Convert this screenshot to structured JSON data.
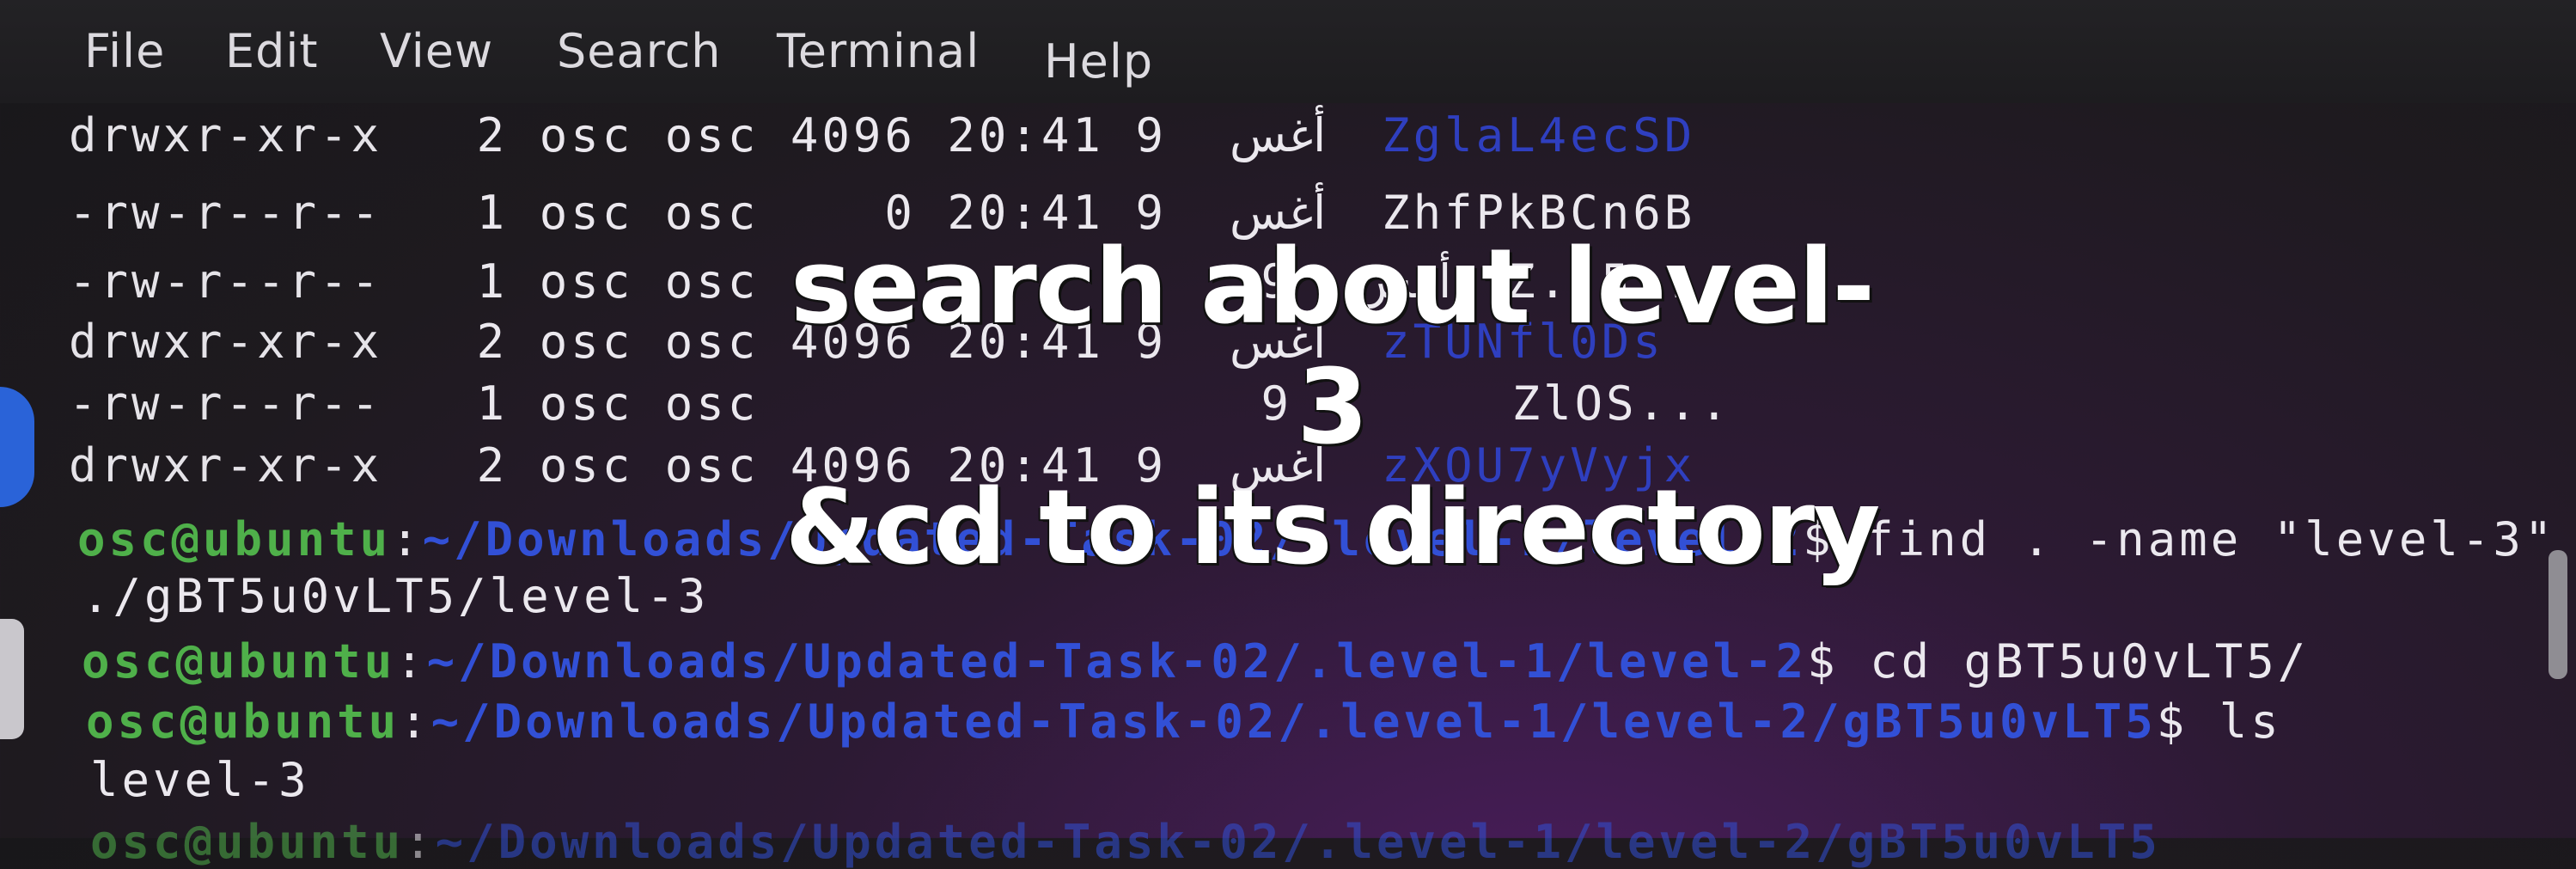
{
  "menu": {
    "file": "File",
    "edit": "Edit",
    "view": "View",
    "search": "Search",
    "terminal": "Terminal",
    "help": "Help"
  },
  "listing": [
    {
      "perms": "drwxr-xr-x",
      "links": "2",
      "owner": "osc",
      "group": "osc",
      "size": "4096",
      "time": "20:41",
      "day": "9",
      "month": "أغس",
      "name": "ZglaL4ecSD"
    },
    {
      "perms": "-rw-r--r--",
      "links": "1",
      "owner": "osc",
      "group": "osc",
      "size": "0",
      "time": "20:41",
      "day": "9",
      "month": "أغس",
      "name": "ZhfPkBCn6B"
    },
    {
      "perms": "-rw-r--r--",
      "links": "1",
      "owner": "osc",
      "group": "osc",
      "size": "",
      "time": "",
      "day": "9",
      "month": "أغس",
      "name": "Z..5..."
    },
    {
      "perms": "drwxr-xr-x",
      "links": "2",
      "owner": "osc",
      "group": "osc",
      "size": "4096",
      "time": "20:41",
      "day": "9",
      "month": "أغس",
      "name": "zTUNfl0Ds"
    },
    {
      "perms": "-rw-r--r--",
      "links": "1",
      "owner": "osc",
      "group": "osc",
      "size": "",
      "time": "",
      "day": "9",
      "month": "",
      "name": "ZlOS..."
    },
    {
      "perms": "drwxr-xr-x",
      "links": "2",
      "owner": "osc",
      "group": "osc",
      "size": "4096",
      "time": "20:41",
      "day": "9",
      "month": "أغس",
      "name": "zXOU7yVyjx"
    }
  ],
  "prompts": {
    "user": "osc@ubuntu",
    "path1": "~/Downloads/Updated-Task-02/.level-1/level-2",
    "cmd1": "$ find . -name \"level-3\"",
    "out1": "./gBT5u0vLT5/level-3",
    "path2": "~/Downloads/Updated-Task-02/.level-1/level-2",
    "cmd2": "$ cd gBT5u0vLT5/",
    "path3": "~/Downloads/Updated-Task-02/.level-1/level-2/gBT5u0vLT5",
    "cmd3": "$ ls",
    "out3": "level-3",
    "path4": "~/Downloads/Updated-Task-02/.level-1/level-2/gBT5u0vLT5"
  },
  "overlay": {
    "line1": "search about level-3",
    "line2": "&cd to its directory"
  },
  "colors": {
    "prompt_user": "#4fb04a",
    "prompt_path": "#3250d6",
    "dir_name": "#2f3fbf"
  }
}
